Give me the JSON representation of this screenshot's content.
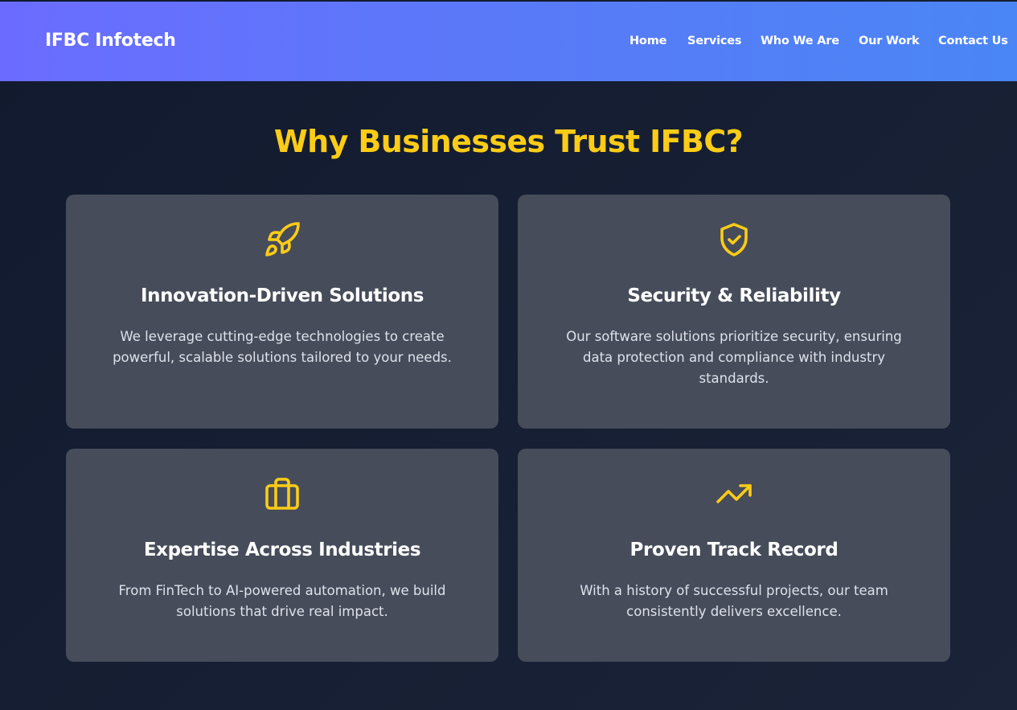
{
  "header": {
    "brand": "IFBC Infotech",
    "nav": [
      "Home",
      "Services",
      "Who We Are",
      "Our Work",
      "Contact Us"
    ]
  },
  "section": {
    "title": "Why Businesses Trust IFBC?"
  },
  "cards": [
    {
      "icon": "rocket-icon",
      "title": "Innovation-Driven Solutions",
      "description": "We leverage cutting-edge technologies to create powerful, scalable solutions tailored to your needs."
    },
    {
      "icon": "shield-check-icon",
      "title": "Security & Reliability",
      "description": "Our software solutions prioritize security, ensuring data protection and compliance with industry standards."
    },
    {
      "icon": "briefcase-icon",
      "title": "Expertise Across Industries",
      "description": "From FinTech to AI-powered automation, we build solutions that drive real impact."
    },
    {
      "icon": "trending-up-icon",
      "title": "Proven Track Record",
      "description": "With a history of successful projects, our team consistently delivers excellence."
    }
  ],
  "colors": {
    "accent": "#fccc16",
    "header_gradient_start": "#6b6cff",
    "header_gradient_end": "#4a86f5",
    "background": "#161e31",
    "card": "#464c5a"
  }
}
